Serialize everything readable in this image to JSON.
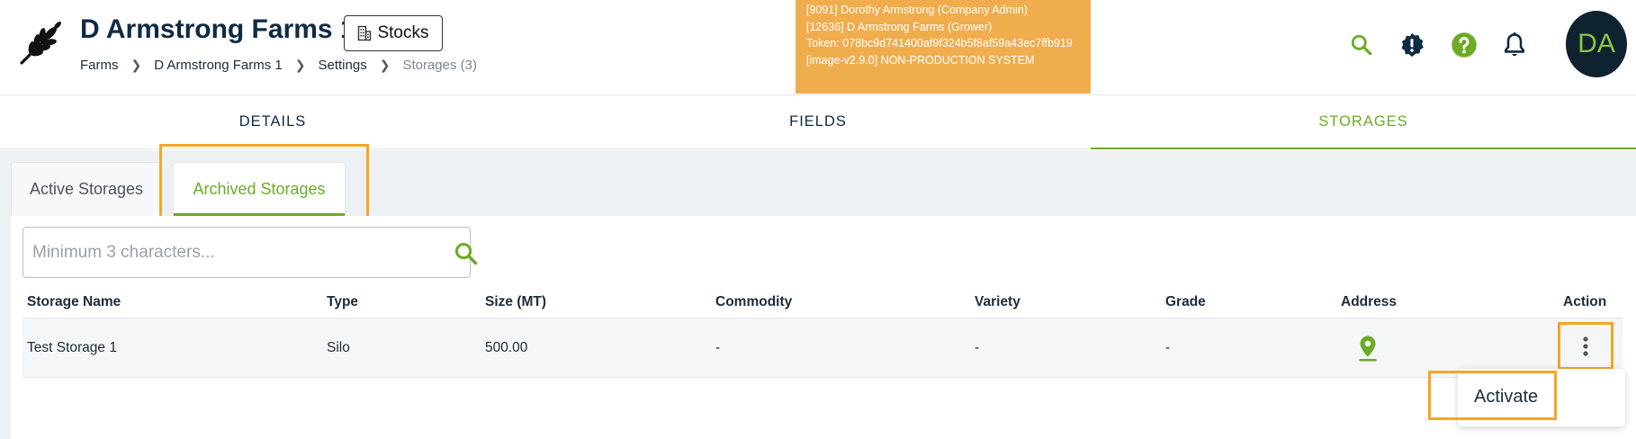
{
  "header": {
    "title": "D Armstrong Farms 1",
    "stocks_label": "Stocks",
    "breadcrumb": [
      "Farms",
      "D Armstrong Farms 1",
      "Settings",
      "Storages (3)"
    ],
    "env_banner": [
      "[9091] Dorothy Armstrong (Company Admin)",
      "[12636] D Armstrong Farms (Grower)",
      "Token: 078bc9d741400af9f324b5f8af59a43ec7ffb919",
      "[image-v2.9.0] NON-PRODUCTION SYSTEM"
    ],
    "avatar_initials": "DA",
    "icons": [
      "search-icon",
      "alert-badge-icon",
      "help-icon",
      "bell-icon"
    ]
  },
  "main_tabs": [
    {
      "label": "DETAILS",
      "active": false
    },
    {
      "label": "FIELDS",
      "active": false
    },
    {
      "label": "STORAGES",
      "active": true
    }
  ],
  "sub_tabs": [
    {
      "label": "Active Storages",
      "active": false
    },
    {
      "label": "Archived Storages",
      "active": true
    }
  ],
  "search": {
    "placeholder": "Minimum 3 characters...",
    "value": ""
  },
  "table": {
    "columns": [
      "Storage Name",
      "Type",
      "Size (MT)",
      "Commodity",
      "Variety",
      "Grade",
      "Address",
      "Action"
    ],
    "rows": [
      {
        "storage_name": "Test Storage 1",
        "type": "Silo",
        "size": "500.00",
        "commodity": "-",
        "variety": "-",
        "grade": "-",
        "address_icon": "map-pin-icon",
        "action_icon": "more-vertical-icon"
      }
    ]
  },
  "action_menu": {
    "items": [
      "Activate"
    ]
  },
  "colors": {
    "accent_green": "#6cab26",
    "navy": "#0f2a44",
    "banner_orange": "#f0ad4e",
    "highlight_orange": "#f5a623"
  }
}
